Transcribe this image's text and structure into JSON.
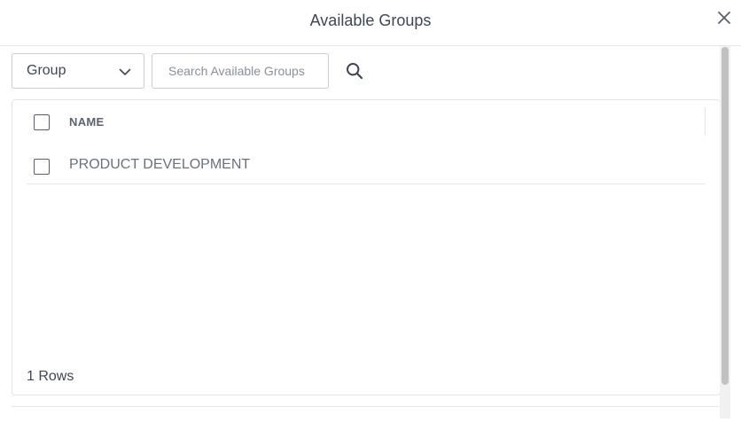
{
  "dialog": {
    "title": "Available Groups"
  },
  "toolbar": {
    "filter_select": {
      "selected": "Group"
    },
    "search": {
      "placeholder": "Search Available Groups",
      "value": ""
    }
  },
  "grid": {
    "columns": [
      {
        "label": "NAME"
      }
    ],
    "rows": [
      {
        "name": "PRODUCT DEVELOPMENT",
        "checked": false
      }
    ],
    "row_count_label": "1 Rows"
  },
  "icons": {
    "close": "close-icon",
    "dropdown": "chevron-down-icon",
    "search": "search-icon"
  },
  "colors": {
    "text": "#3f4654",
    "muted_text": "#6b717c",
    "border": "#c9ccd2",
    "divider": "#e6e8ec"
  }
}
